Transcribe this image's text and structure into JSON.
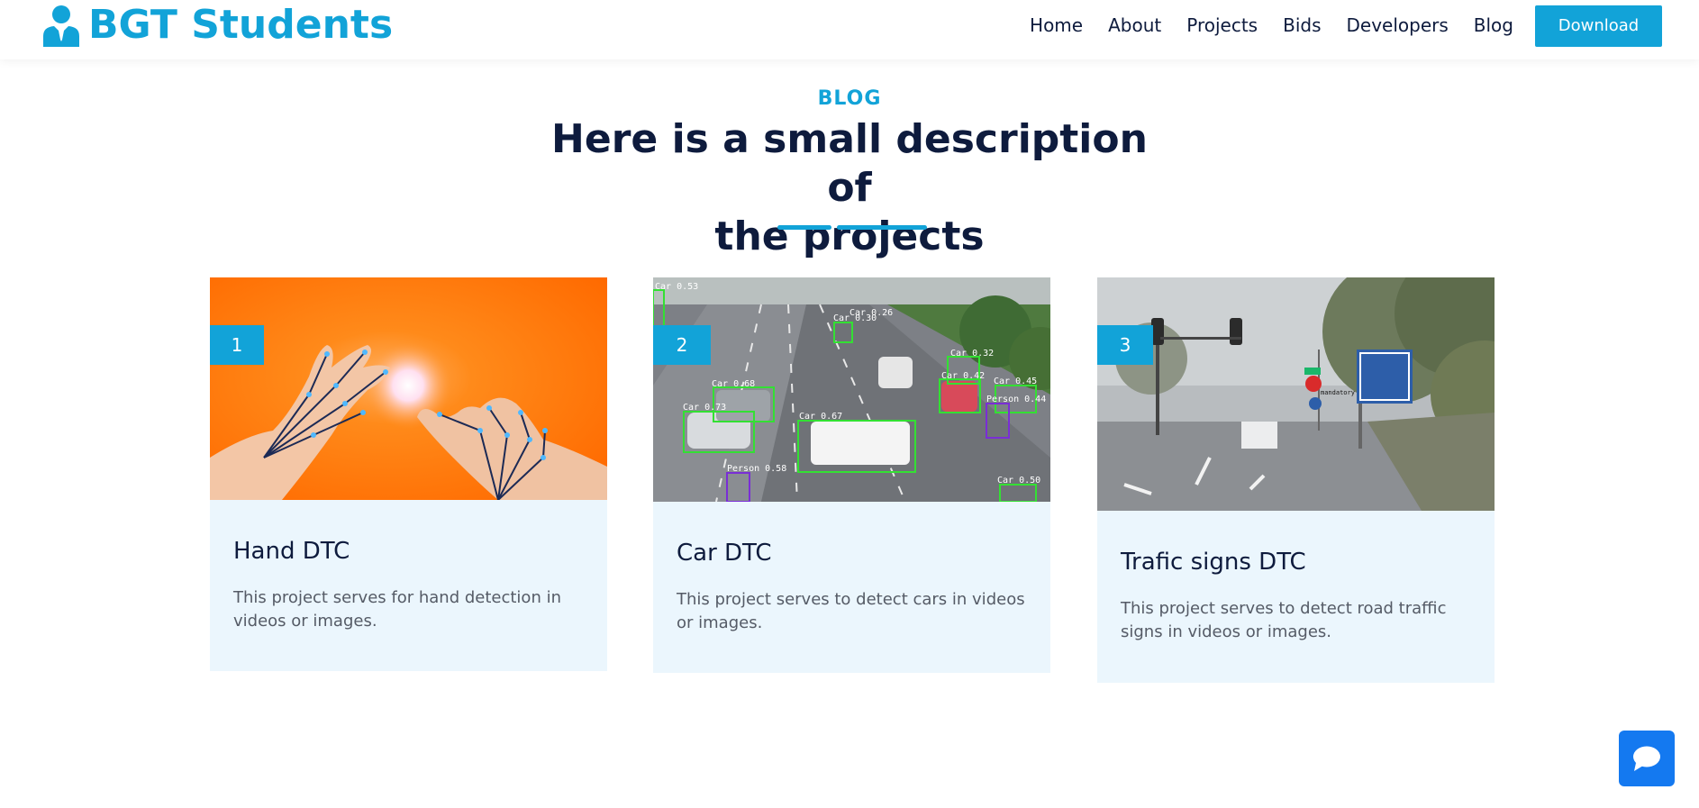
{
  "brand": {
    "name": "BGT Students",
    "icon": "user-tie-icon",
    "color": "#12a3d8"
  },
  "nav": {
    "items": [
      "Home",
      "About",
      "Projects",
      "Bids",
      "Developers",
      "Blog"
    ],
    "download_label": "Download"
  },
  "section": {
    "eyebrow": "BLOG",
    "heading_line1": "Here is a small description of",
    "heading_line2": "the projects"
  },
  "cards": [
    {
      "number": "1",
      "title": "Hand DTC",
      "description": "This project serves for hand detection in videos or images.",
      "image": "hand-tracking-photo"
    },
    {
      "number": "2",
      "title": "Car DTC",
      "description": "This project serves to detect cars in videos or images.",
      "image": "car-detection-photo"
    },
    {
      "number": "3",
      "title": "Trafic signs DTC",
      "description": "This project serves to detect road traffic signs in videos or images.",
      "image": "traffic-signs-photo"
    }
  ],
  "chat": {
    "icon": "chat-bubble-icon",
    "color": "#1479f0"
  }
}
